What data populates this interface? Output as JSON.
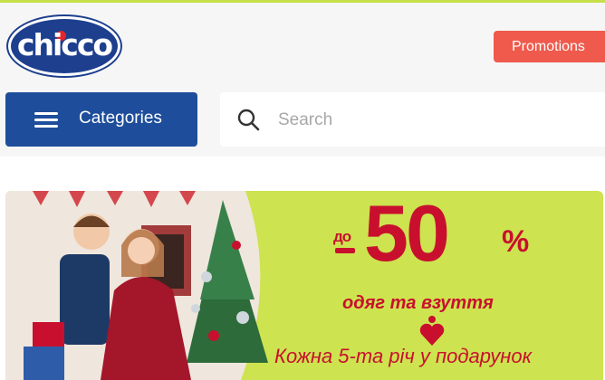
{
  "brand": {
    "logo_text": "chicco",
    "color": "#1d3f8e"
  },
  "header": {
    "promotions_label": "Promotions",
    "categories_label": "Categories",
    "search": {
      "placeholder": "Search",
      "value": ""
    }
  },
  "banner": {
    "prefix": "до",
    "discount": "50",
    "percent_sign": "%",
    "subtitle": "одяг та взуття",
    "offer": "Кожна 5-та річ у подарунок",
    "background_color": "#cde34f",
    "accent_color": "#c8102e"
  }
}
